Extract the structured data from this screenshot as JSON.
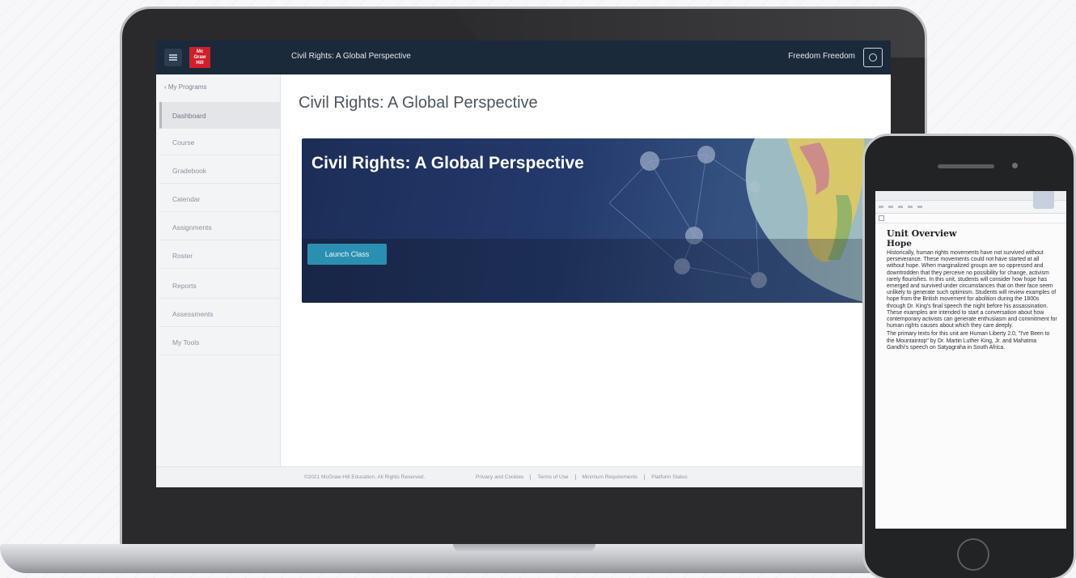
{
  "app": {
    "logo_text": [
      "Mc",
      "Graw",
      "Hill"
    ],
    "topbar_title": "Civil Rights: A Global Perspective",
    "user_name": "Freedom Freedom"
  },
  "sidebar": {
    "back_label": "My Programs",
    "items": [
      {
        "label": "Dashboard",
        "active": true
      },
      {
        "label": "Course"
      },
      {
        "label": "Gradebook"
      },
      {
        "label": "Calendar"
      },
      {
        "label": "Assignments"
      },
      {
        "label": "Roster"
      },
      {
        "label": "Reports"
      },
      {
        "label": "Assessments"
      },
      {
        "label": "My Tools"
      }
    ]
  },
  "main": {
    "page_title": "Civil Rights: A Global Perspective",
    "banner_title": "Civil Rights: A Global Perspective",
    "launch_label": "Launch Class"
  },
  "footer": {
    "copyright": "©2021 McGraw-Hill Education. All Rights Reserved.",
    "links": [
      "Privacy and Cookies",
      "Terms of Use",
      "Minimum Requirements",
      "Platform Status"
    ]
  },
  "phone": {
    "heading": "Unit Overview",
    "subheading": "Hope",
    "paragraphs": [
      "Historically, human rights movements have not survived without perseverance. These movements could not have started at all without hope. When marginalized groups are so oppressed and downtrodden that they perceive no possibility for change, activism rarely flourishes. In this unit, students will consider how hope has emerged and survived under circumstances that on their face seem unlikely to generate such optimism. Students will review examples of hope from the British movement for abolition during the 1800s through Dr. King's final speech the night before his assassination. These examples are intended to start a conversation about how contemporary activists can generate enthusiasm and commitment for human rights causes about which they care deeply.",
      "The primary texts for this unit are Human Liberty 2.0, \"I've Been to the Mountaintop\" by Dr. Martin Luther King, Jr. and Mahatma Gandhi's speech on Satyagraha in South Africa."
    ]
  },
  "colors": {
    "topbar": "#1b2a3b",
    "banner": "#243a6d",
    "launch_button": "#2b8fb1",
    "logo": "#d11e2a"
  }
}
